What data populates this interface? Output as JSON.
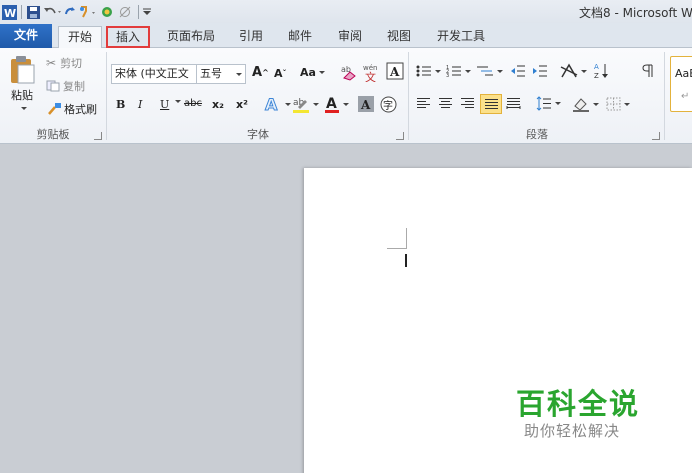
{
  "titlebar": {
    "title": "文档8 - Microsoft W"
  },
  "tabs": {
    "file": "文件",
    "home": "开始",
    "insert": "插入",
    "page_layout": "页面布局",
    "references": "引用",
    "mailings": "邮件",
    "review": "审阅",
    "view": "视图",
    "developer": "开发工具"
  },
  "clipboard": {
    "paste": "粘贴",
    "cut": "剪切",
    "copy": "复制",
    "format_painter": "格式刷",
    "label": "剪贴板"
  },
  "font": {
    "font_name": "宋体 (中文正文",
    "font_size": "五号",
    "bold": "B",
    "italic": "I",
    "underline": "U",
    "strikethrough": "abc",
    "subscript": "x₂",
    "superscript": "x²",
    "grow": "A",
    "shrink": "A",
    "change_case": "Aa",
    "label": "字体"
  },
  "paragraph": {
    "label": "段落"
  },
  "styles": {
    "preview": "AaB"
  },
  "watermark": {
    "title": "百科全说",
    "subtitle": "助你轻松解决"
  },
  "colors": {
    "file_tab": "#2f72c8",
    "insert_highlight": "#e23c3c",
    "watermark_green": "#2aa52f"
  }
}
